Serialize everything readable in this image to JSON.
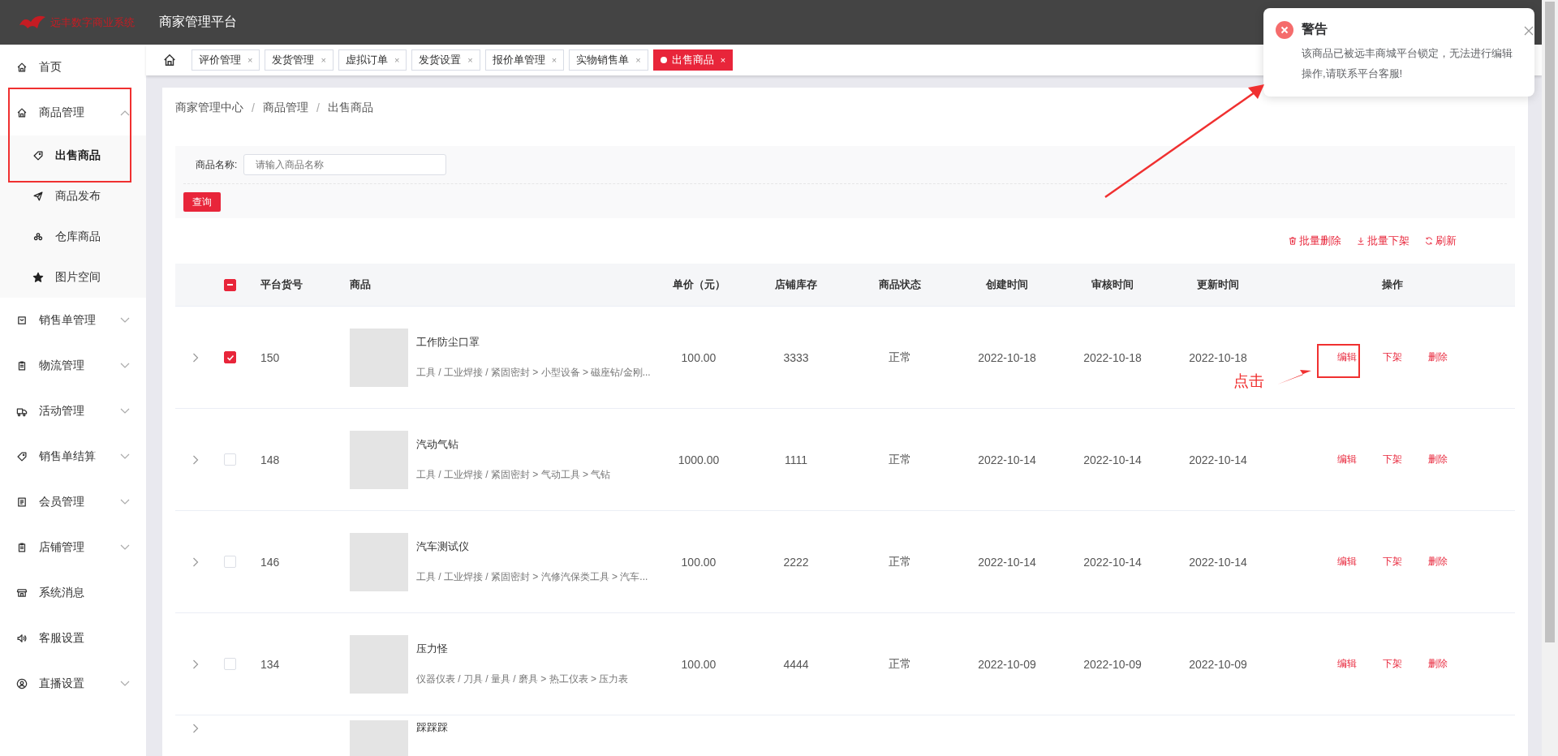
{
  "header": {
    "brand": "远丰数字商业系统",
    "title": "商家管理平台"
  },
  "sidebar": {
    "items": [
      {
        "label": "首页",
        "kind": "link",
        "selected": false
      },
      {
        "label": "商品管理",
        "kind": "group",
        "expanded": true,
        "selected": false,
        "children": [
          {
            "label": "出售商品",
            "selected": true
          },
          {
            "label": "商品发布",
            "selected": false
          },
          {
            "label": "仓库商品",
            "selected": false
          },
          {
            "label": "图片空间",
            "selected": false
          }
        ]
      },
      {
        "label": "销售单管理",
        "kind": "group",
        "expanded": false,
        "selected": false
      },
      {
        "label": "物流管理",
        "kind": "group",
        "expanded": false,
        "selected": false
      },
      {
        "label": "活动管理",
        "kind": "group",
        "expanded": false,
        "selected": false
      },
      {
        "label": "销售单结算",
        "kind": "group",
        "expanded": false,
        "selected": false
      },
      {
        "label": "会员管理",
        "kind": "group",
        "expanded": false,
        "selected": false
      },
      {
        "label": "店铺管理",
        "kind": "group",
        "expanded": false,
        "selected": false
      },
      {
        "label": "系统消息",
        "kind": "link",
        "selected": false
      },
      {
        "label": "客服设置",
        "kind": "link",
        "selected": false
      },
      {
        "label": "直播设置",
        "kind": "group",
        "expanded": false,
        "selected": false
      }
    ]
  },
  "tabs": [
    {
      "label": "评价管理",
      "close": "×",
      "selected": false
    },
    {
      "label": "发货管理",
      "close": "×",
      "selected": false
    },
    {
      "label": "虚拟订单",
      "close": "×",
      "selected": false
    },
    {
      "label": "发货设置",
      "close": "×",
      "selected": false
    },
    {
      "label": "报价单管理",
      "close": "×",
      "selected": false
    },
    {
      "label": "实物销售单",
      "close": "×",
      "selected": false
    },
    {
      "label": "出售商品",
      "close": "×",
      "selected": true
    }
  ],
  "breadcrumb": {
    "separator": "/",
    "items": [
      "商家管理中心",
      "商品管理",
      "出售商品"
    ]
  },
  "search": {
    "label": "商品名称:",
    "placeholder": "请输入商品名称",
    "button": "查询"
  },
  "toolbar": [
    {
      "label": "批量删除",
      "kind": "delete"
    },
    {
      "label": "批量下架",
      "kind": "unlist"
    },
    {
      "label": "刷新",
      "kind": "refresh"
    }
  ],
  "table": {
    "select_all": {
      "indeterminate": true
    },
    "columns": [
      "平台货号",
      "商品",
      "单价（元）",
      "店铺库存",
      "商品状态",
      "创建时间",
      "审核时间",
      "更新时间",
      "操作"
    ],
    "rows": [
      {
        "checked": true,
        "id": "150",
        "name": "工作防尘口罩",
        "category": "工具 / 工业焊接 / 紧固密封 > 小型设备 > 磁座钻/金刚...",
        "price": "100.00",
        "stock": "3333",
        "status": "正常",
        "created": "2022-10-18",
        "reviewed": "2022-10-18",
        "updated": "2022-10-18",
        "actions": [
          "编辑",
          "下架",
          "删除"
        ]
      },
      {
        "checked": false,
        "id": "148",
        "name": "汽动气钻",
        "category": "工具 / 工业焊接 / 紧固密封 > 气动工具 > 气钻",
        "price": "1000.00",
        "stock": "1111",
        "status": "正常",
        "created": "2022-10-14",
        "reviewed": "2022-10-14",
        "updated": "2022-10-14",
        "actions": [
          "编辑",
          "下架",
          "删除"
        ]
      },
      {
        "checked": false,
        "id": "146",
        "name": "汽车测试仪",
        "category": "工具 / 工业焊接 / 紧固密封 > 汽修汽保类工具 > 汽车...",
        "price": "100.00",
        "stock": "2222",
        "status": "正常",
        "created": "2022-10-14",
        "reviewed": "2022-10-14",
        "updated": "2022-10-14",
        "actions": [
          "编辑",
          "下架",
          "删除"
        ]
      },
      {
        "checked": false,
        "id": "134",
        "name": "压力怪",
        "category": "仪器仪表 / 刀具 / 量具 / 磨具 > 热工仪表 > 压力表",
        "price": "100.00",
        "stock": "4444",
        "status": "正常",
        "created": "2022-10-09",
        "reviewed": "2022-10-09",
        "updated": "2022-10-09",
        "actions": [
          "编辑",
          "下架",
          "删除"
        ]
      },
      {
        "name": "踩踩踩"
      }
    ]
  },
  "notification": {
    "title": "警告",
    "message": "该商品已被远丰商城平台锁定，无法进行编辑操作,请联系平台客服!"
  },
  "annotation": {
    "label": "点击"
  }
}
